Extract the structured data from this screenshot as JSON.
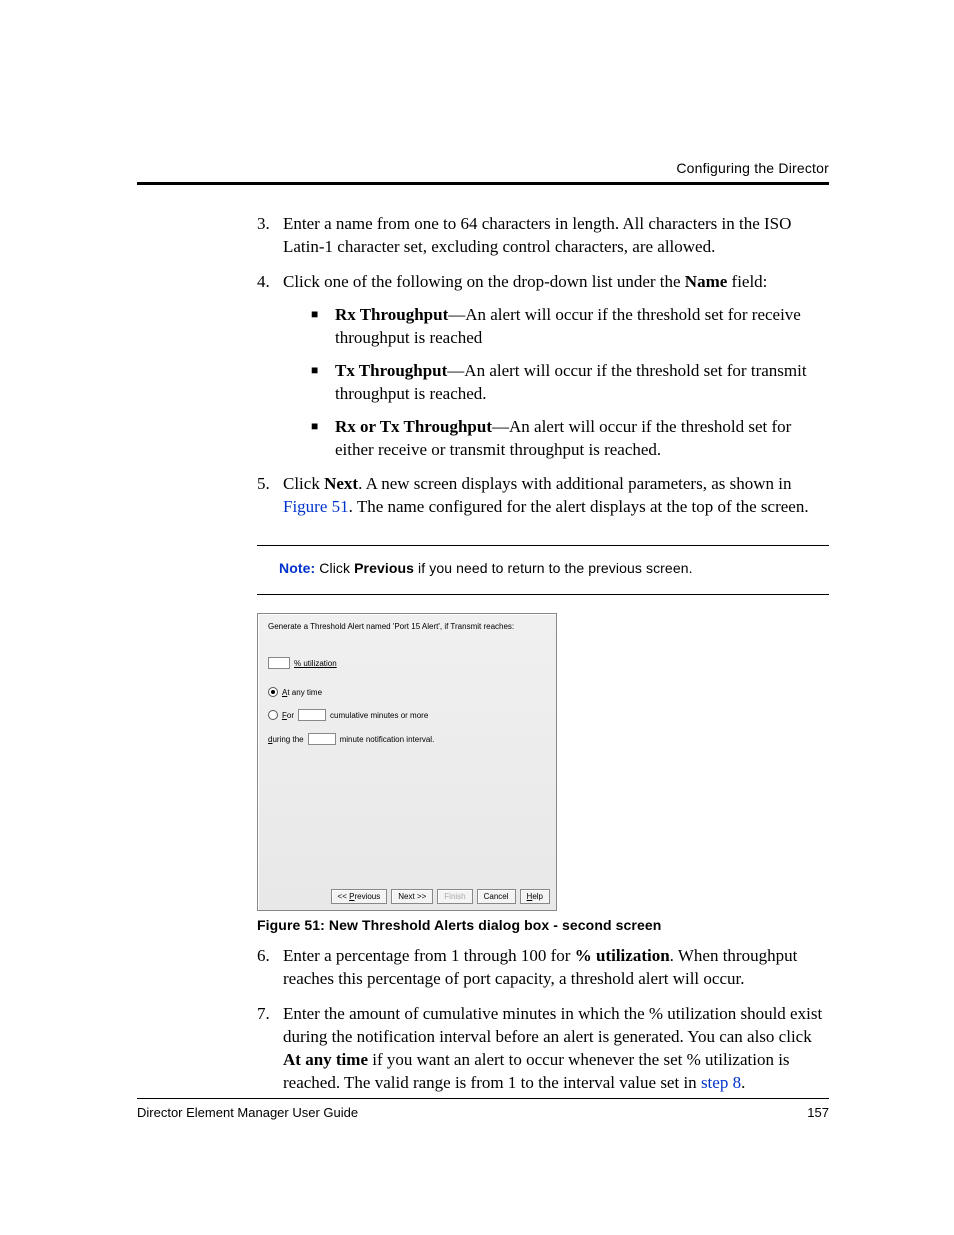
{
  "header": {
    "running_title": "Configuring the Director"
  },
  "steps": {
    "s3": {
      "num": "3.",
      "text": "Enter a name from one to 64 characters in length. All characters in the ISO Latin-1 character set, excluding control characters, are allowed."
    },
    "s4": {
      "num": "4.",
      "lead": "Click one of the following on the drop-down list under the ",
      "name_bold": "Name",
      "tail": " field:",
      "items": [
        {
          "label": "Rx Throughput",
          "text": "—An alert will occur if the threshold set for receive throughput is reached"
        },
        {
          "label": "Tx Throughput",
          "text": "—An alert will occur if the threshold set for transmit throughput is reached."
        },
        {
          "label": "Rx or Tx Throughput",
          "text": "—An alert will occur if the threshold set for either receive or transmit throughput is reached."
        }
      ]
    },
    "s5": {
      "num": "5.",
      "a": "Click ",
      "next_bold": "Next",
      "b": ". A new screen displays with additional parameters, as shown in ",
      "figref": "Figure 51",
      "c": ". The name configured for the alert displays at the top of the screen."
    },
    "s6": {
      "num": "6.",
      "a": "Enter a percentage from 1 through 100 for ",
      "util_bold": "% utilization",
      "b": ". When throughput reaches this percentage of port capacity, a threshold alert will occur."
    },
    "s7": {
      "num": "7.",
      "a": "Enter the amount of cumulative minutes in which the % utilization should exist during the notification interval before an alert is generated. You can also click ",
      "any_bold": "At any time",
      "b": " if you want an alert to occur whenever the set % utilization is reached. The valid range is from 1 to the interval value set in ",
      "stepref": "step 8",
      "c": "."
    }
  },
  "note": {
    "label": "Note:",
    "a": "  Click ",
    "prev": "Previous",
    "b": " if you need to return to the previous screen."
  },
  "dialog": {
    "title": "Generate a Threshold Alert named 'Port 15 Alert',  if Transmit reaches:",
    "util_label": "% utilization",
    "at_any_a": "A",
    "at_any_rest": "t any time",
    "for_f": "F",
    "for_rest": "or",
    "for_tail": "cumulative minutes or more",
    "during_d": "d",
    "during_rest": "uring the",
    "during_tail": "minute notification interval.",
    "btn_prev_l": "P",
    "btn_prev": "<< Previous",
    "btn_next": "Next >>",
    "btn_finish": "Finish",
    "btn_cancel": "Cancel",
    "btn_help_l": "H",
    "btn_help": "Help"
  },
  "caption": "Figure 51:  New Threshold Alerts dialog box - second screen",
  "footer": {
    "guide": "Director Element Manager User Guide",
    "page": "157"
  }
}
